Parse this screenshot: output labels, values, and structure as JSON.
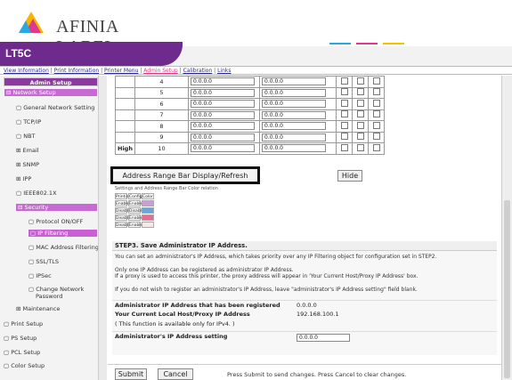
{
  "brand": {
    "logo_text": "AFINIA LABEL",
    "model": "LT5C"
  },
  "accent_colors": {
    "purple": "#6e2a8c",
    "sidebar_highlight": "#c95fd2",
    "nav_active": "#e0388a"
  },
  "nav": [
    "View Information",
    "Print Information",
    "Printer Menu",
    "Admin Setup",
    "Calibration",
    "Links"
  ],
  "sidebar": {
    "header": "Admin Setup",
    "items": [
      "Network Setup",
      "General Network Setting",
      "TCP/IP",
      "NBT",
      "Email",
      "SNMP",
      "IPP",
      "IEEE802.1X",
      "Security",
      "Protocol ON/OFF",
      "IP Filtering",
      "MAC Address Filtering",
      "SSL/TLS",
      "IPSec",
      "Change Network",
      "Password",
      "Maintenance",
      "Print Setup",
      "PS Setup",
      "PCL Setup",
      "Color Setup"
    ]
  },
  "ip_table": {
    "rows": [
      {
        "num": "4",
        "start": "0.0.0.0",
        "end": "0.0.0.0"
      },
      {
        "num": "5",
        "start": "0.0.0.0",
        "end": "0.0.0.0"
      },
      {
        "num": "6",
        "start": "0.0.0.0",
        "end": "0.0.0.0"
      },
      {
        "num": "7",
        "start": "0.0.0.0",
        "end": "0.0.0.0"
      },
      {
        "num": "8",
        "start": "0.0.0.0",
        "end": "0.0.0.0"
      },
      {
        "num": "9",
        "start": "0.0.0.0",
        "end": "0.0.0.0"
      },
      {
        "num": "10",
        "start": "0.0.0.0",
        "end": "0.0.0.0",
        "priority": "High"
      }
    ]
  },
  "buttons": {
    "range_bar": "Address Range Bar Display/Refresh",
    "hide": "Hide",
    "submit": "Submit",
    "cancel": "Cancel"
  },
  "legend": {
    "caption": "Settings and Address Range Bar Color relation",
    "headers": [
      "Printing",
      "Config",
      "Color"
    ],
    "rows": [
      [
        "Enable",
        "Enable"
      ],
      [
        "Disable",
        "Disable"
      ],
      [
        "Disable",
        "Enable"
      ],
      [
        "Disable",
        "Enable"
      ]
    ],
    "colors": [
      "#c8a0d8",
      "#6aa6d8",
      "#e07090",
      "#f7e6ea"
    ]
  },
  "step3": {
    "title": "STEP3.  Save Administrator IP Address.",
    "p1": "You can set an administrator's IP Address, which takes priority over any IP Filtering object for configuration set in STEP2.",
    "p2": "Only one IP Address can be registered as administrator IP Address.",
    "p3": "If a proxy is used to access this printer, the proxy address will appear in 'Your Current Host/Proxy IP Address' box.",
    "p4": "If you do not wish to register an administrator's IP Address, leave \"administrator's IP Address setting\" field blank.",
    "registered_label": "Administrator IP Address that has been registered",
    "registered_value": "0.0.0.0",
    "current_label": "Your Current Local Host/Proxy IP Address",
    "current_value": "192.168.100.1",
    "note": "( This function is available only for IPv4. )",
    "setting_label": "Administrator's IP Address setting",
    "setting_value": "0.0.0.0"
  },
  "footer_note": "Press Submit to send changes. Press Cancel to clear changes."
}
